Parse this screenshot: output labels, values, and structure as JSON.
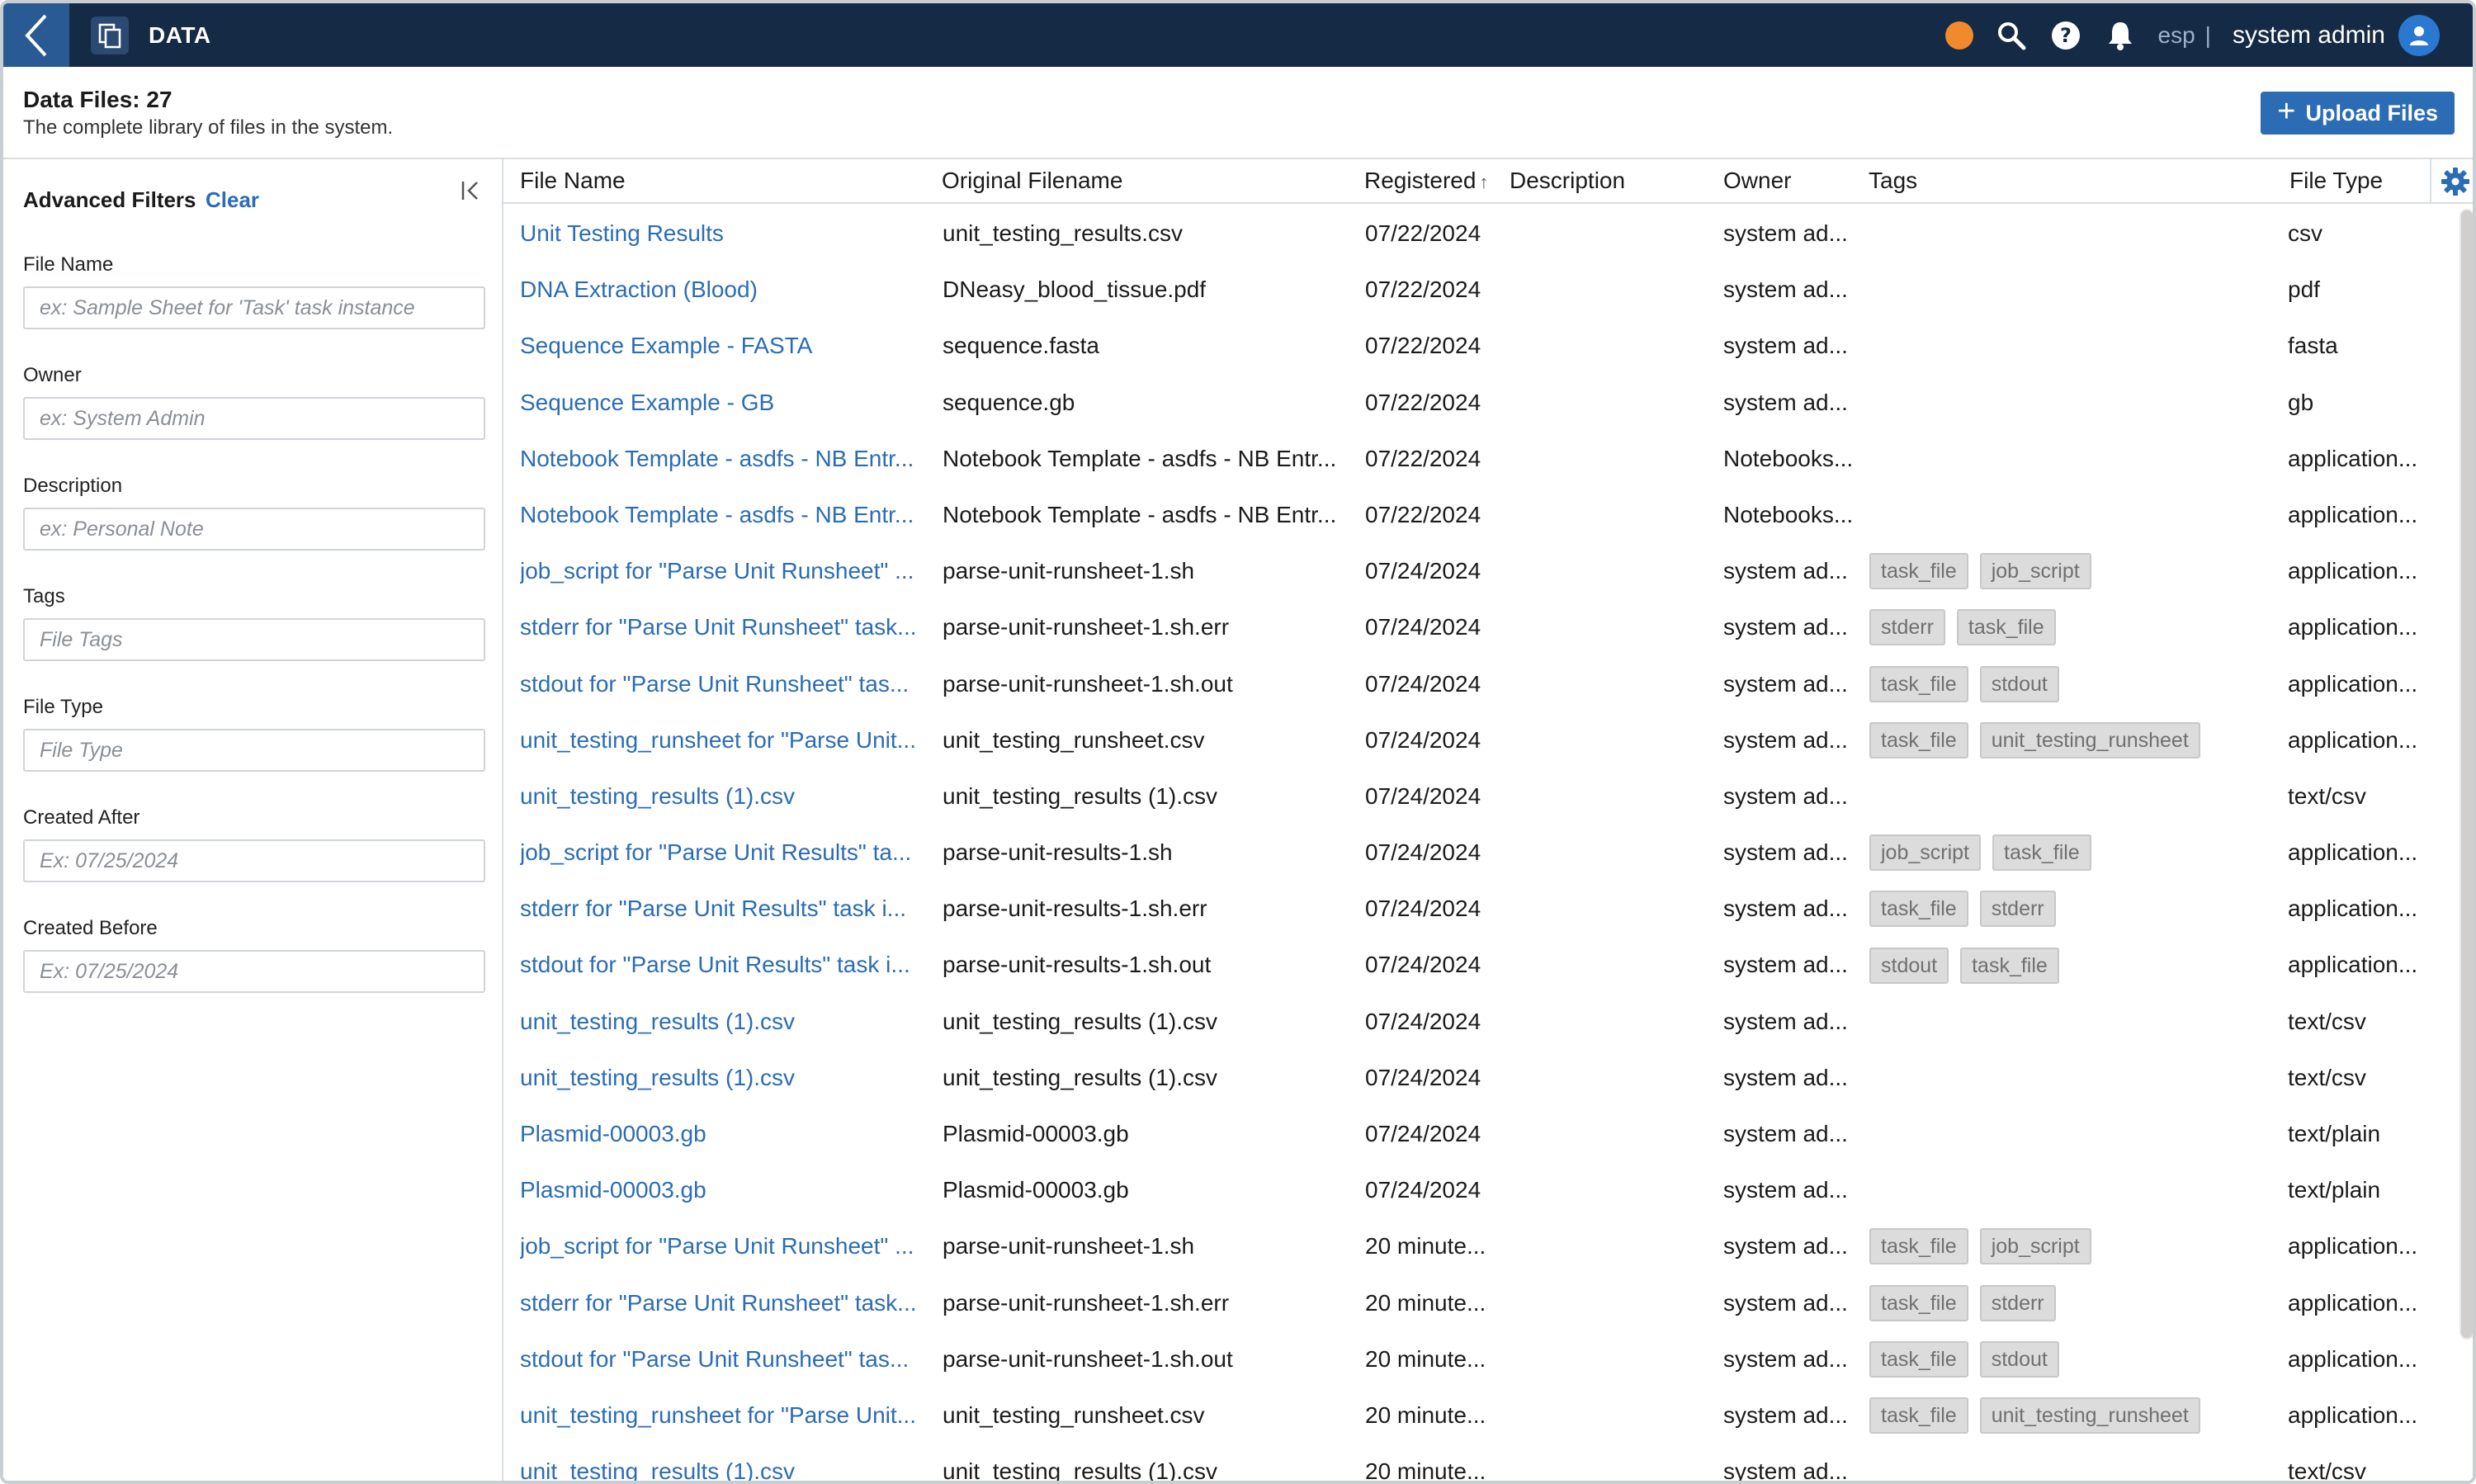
{
  "app": {
    "title": "DATA",
    "lang": "esp",
    "user": "system admin",
    "status_color": "#f08a2c"
  },
  "header": {
    "title": "Data Files: 27",
    "subtitle": "The complete library of files in the system.",
    "upload_label": "Upload Files"
  },
  "filters": {
    "title": "Advanced Filters",
    "clear_label": "Clear",
    "fields": [
      {
        "label": "File Name",
        "placeholder": "ex: Sample Sheet for 'Task' task instance"
      },
      {
        "label": "Owner",
        "placeholder": "ex: System Admin"
      },
      {
        "label": "Description",
        "placeholder": "ex: Personal Note"
      },
      {
        "label": "Tags",
        "placeholder": "File Tags"
      },
      {
        "label": "File Type",
        "placeholder": "File Type"
      },
      {
        "label": "Created After",
        "placeholder": "Ex: 07/25/2024"
      },
      {
        "label": "Created Before",
        "placeholder": "Ex: 07/25/2024"
      }
    ]
  },
  "table": {
    "columns": [
      "File Name",
      "Original Filename",
      "Registered",
      "Description",
      "Owner",
      "Tags",
      "File Type"
    ],
    "sort_indicator": "↑",
    "rows": [
      {
        "name": "Unit Testing Results",
        "original": "unit_testing_results.csv",
        "registered": "07/22/2024",
        "description": "",
        "owner": "system ad...",
        "tags": [],
        "type": "csv"
      },
      {
        "name": "DNA Extraction (Blood)",
        "original": "DNeasy_blood_tissue.pdf",
        "registered": "07/22/2024",
        "description": "",
        "owner": "system ad...",
        "tags": [],
        "type": "pdf"
      },
      {
        "name": "Sequence Example - FASTA",
        "original": "sequence.fasta",
        "registered": "07/22/2024",
        "description": "",
        "owner": "system ad...",
        "tags": [],
        "type": "fasta"
      },
      {
        "name": "Sequence Example - GB",
        "original": "sequence.gb",
        "registered": "07/22/2024",
        "description": "",
        "owner": "system ad...",
        "tags": [],
        "type": "gb"
      },
      {
        "name": "Notebook Template - asdfs - NB Entr...",
        "original": "Notebook Template - asdfs - NB Entr...",
        "registered": "07/22/2024",
        "description": "",
        "owner": "Notebooks...",
        "tags": [],
        "type": "application..."
      },
      {
        "name": "Notebook Template - asdfs - NB Entr...",
        "original": "Notebook Template - asdfs - NB Entr...",
        "registered": "07/22/2024",
        "description": "",
        "owner": "Notebooks...",
        "tags": [],
        "type": "application..."
      },
      {
        "name": "job_script for \"Parse Unit Runsheet\" ...",
        "original": "parse-unit-runsheet-1.sh",
        "registered": "07/24/2024",
        "description": "",
        "owner": "system ad...",
        "tags": [
          "task_file",
          "job_script"
        ],
        "type": "application..."
      },
      {
        "name": "stderr for \"Parse Unit Runsheet\" task...",
        "original": "parse-unit-runsheet-1.sh.err",
        "registered": "07/24/2024",
        "description": "",
        "owner": "system ad...",
        "tags": [
          "stderr",
          "task_file"
        ],
        "type": "application..."
      },
      {
        "name": "stdout for \"Parse Unit Runsheet\" tas...",
        "original": "parse-unit-runsheet-1.sh.out",
        "registered": "07/24/2024",
        "description": "",
        "owner": "system ad...",
        "tags": [
          "task_file",
          "stdout"
        ],
        "type": "application..."
      },
      {
        "name": "unit_testing_runsheet for \"Parse Unit...",
        "original": "unit_testing_runsheet.csv",
        "registered": "07/24/2024",
        "description": "",
        "owner": "system ad...",
        "tags": [
          "task_file",
          "unit_testing_runsheet"
        ],
        "type": "application..."
      },
      {
        "name": "unit_testing_results (1).csv",
        "original": "unit_testing_results (1).csv",
        "registered": "07/24/2024",
        "description": "",
        "owner": "system ad...",
        "tags": [],
        "type": "text/csv"
      },
      {
        "name": "job_script for \"Parse Unit Results\" ta...",
        "original": "parse-unit-results-1.sh",
        "registered": "07/24/2024",
        "description": "",
        "owner": "system ad...",
        "tags": [
          "job_script",
          "task_file"
        ],
        "type": "application..."
      },
      {
        "name": "stderr for \"Parse Unit Results\" task i...",
        "original": "parse-unit-results-1.sh.err",
        "registered": "07/24/2024",
        "description": "",
        "owner": "system ad...",
        "tags": [
          "task_file",
          "stderr"
        ],
        "type": "application..."
      },
      {
        "name": "stdout for \"Parse Unit Results\" task i...",
        "original": "parse-unit-results-1.sh.out",
        "registered": "07/24/2024",
        "description": "",
        "owner": "system ad...",
        "tags": [
          "stdout",
          "task_file"
        ],
        "type": "application..."
      },
      {
        "name": "unit_testing_results (1).csv",
        "original": "unit_testing_results (1).csv",
        "registered": "07/24/2024",
        "description": "",
        "owner": "system ad...",
        "tags": [],
        "type": "text/csv"
      },
      {
        "name": "unit_testing_results (1).csv",
        "original": "unit_testing_results (1).csv",
        "registered": "07/24/2024",
        "description": "",
        "owner": "system ad...",
        "tags": [],
        "type": "text/csv"
      },
      {
        "name": "Plasmid-00003.gb",
        "original": "Plasmid-00003.gb",
        "registered": "07/24/2024",
        "description": "",
        "owner": "system ad...",
        "tags": [],
        "type": "text/plain"
      },
      {
        "name": "Plasmid-00003.gb",
        "original": "Plasmid-00003.gb",
        "registered": "07/24/2024",
        "description": "",
        "owner": "system ad...",
        "tags": [],
        "type": "text/plain"
      },
      {
        "name": "job_script for \"Parse Unit Runsheet\" ...",
        "original": "parse-unit-runsheet-1.sh",
        "registered": "20 minute...",
        "description": "",
        "owner": "system ad...",
        "tags": [
          "task_file",
          "job_script"
        ],
        "type": "application..."
      },
      {
        "name": "stderr for \"Parse Unit Runsheet\" task...",
        "original": "parse-unit-runsheet-1.sh.err",
        "registered": "20 minute...",
        "description": "",
        "owner": "system ad...",
        "tags": [
          "task_file",
          "stderr"
        ],
        "type": "application..."
      },
      {
        "name": "stdout for \"Parse Unit Runsheet\" tas...",
        "original": "parse-unit-runsheet-1.sh.out",
        "registered": "20 minute...",
        "description": "",
        "owner": "system ad...",
        "tags": [
          "task_file",
          "stdout"
        ],
        "type": "application..."
      },
      {
        "name": "unit_testing_runsheet for \"Parse Unit...",
        "original": "unit_testing_runsheet.csv",
        "registered": "20 minute...",
        "description": "",
        "owner": "system ad...",
        "tags": [
          "task_file",
          "unit_testing_runsheet"
        ],
        "type": "application..."
      },
      {
        "name": "unit_testing_results (1).csv",
        "original": "unit_testing_results (1).csv",
        "registered": "20 minute...",
        "description": "",
        "owner": "system ad...",
        "tags": [],
        "type": "text/csv"
      }
    ]
  },
  "icons": {
    "back": "chevron-left-icon",
    "app": "copy-icon",
    "search": "search-icon",
    "help": "help-icon",
    "notifications": "bell-icon",
    "user": "user-icon",
    "collapse": "collapse-left-icon",
    "settings": "gear-icon",
    "upload": "plus-icon"
  }
}
